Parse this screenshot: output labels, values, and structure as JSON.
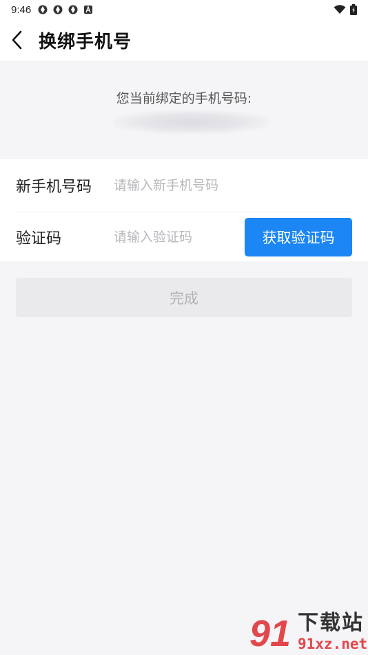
{
  "status_bar": {
    "time": "9:46",
    "left_icons": [
      "notification-icon",
      "notification-icon",
      "notification-icon",
      "a-badge-icon"
    ],
    "right_icons": [
      "wifi-icon",
      "battery-icon"
    ]
  },
  "nav": {
    "title": "换绑手机号",
    "back_icon": "chevron-left-icon"
  },
  "current": {
    "label": "您当前绑定的手机号码:"
  },
  "form": {
    "phone_label": "新手机号码",
    "phone_placeholder": "请输入新手机号码",
    "code_label": "验证码",
    "code_placeholder": "请输入验证码",
    "get_code_button": "获取验证码"
  },
  "done_button": "完成",
  "watermark": {
    "logo": "91",
    "title": "下载站",
    "domain": "91xz.net"
  },
  "colors": {
    "accent": "#1b86f4",
    "background": "#f5f5f8",
    "disabled_button": "#eaeaec",
    "watermark_red": "#e2474b"
  }
}
